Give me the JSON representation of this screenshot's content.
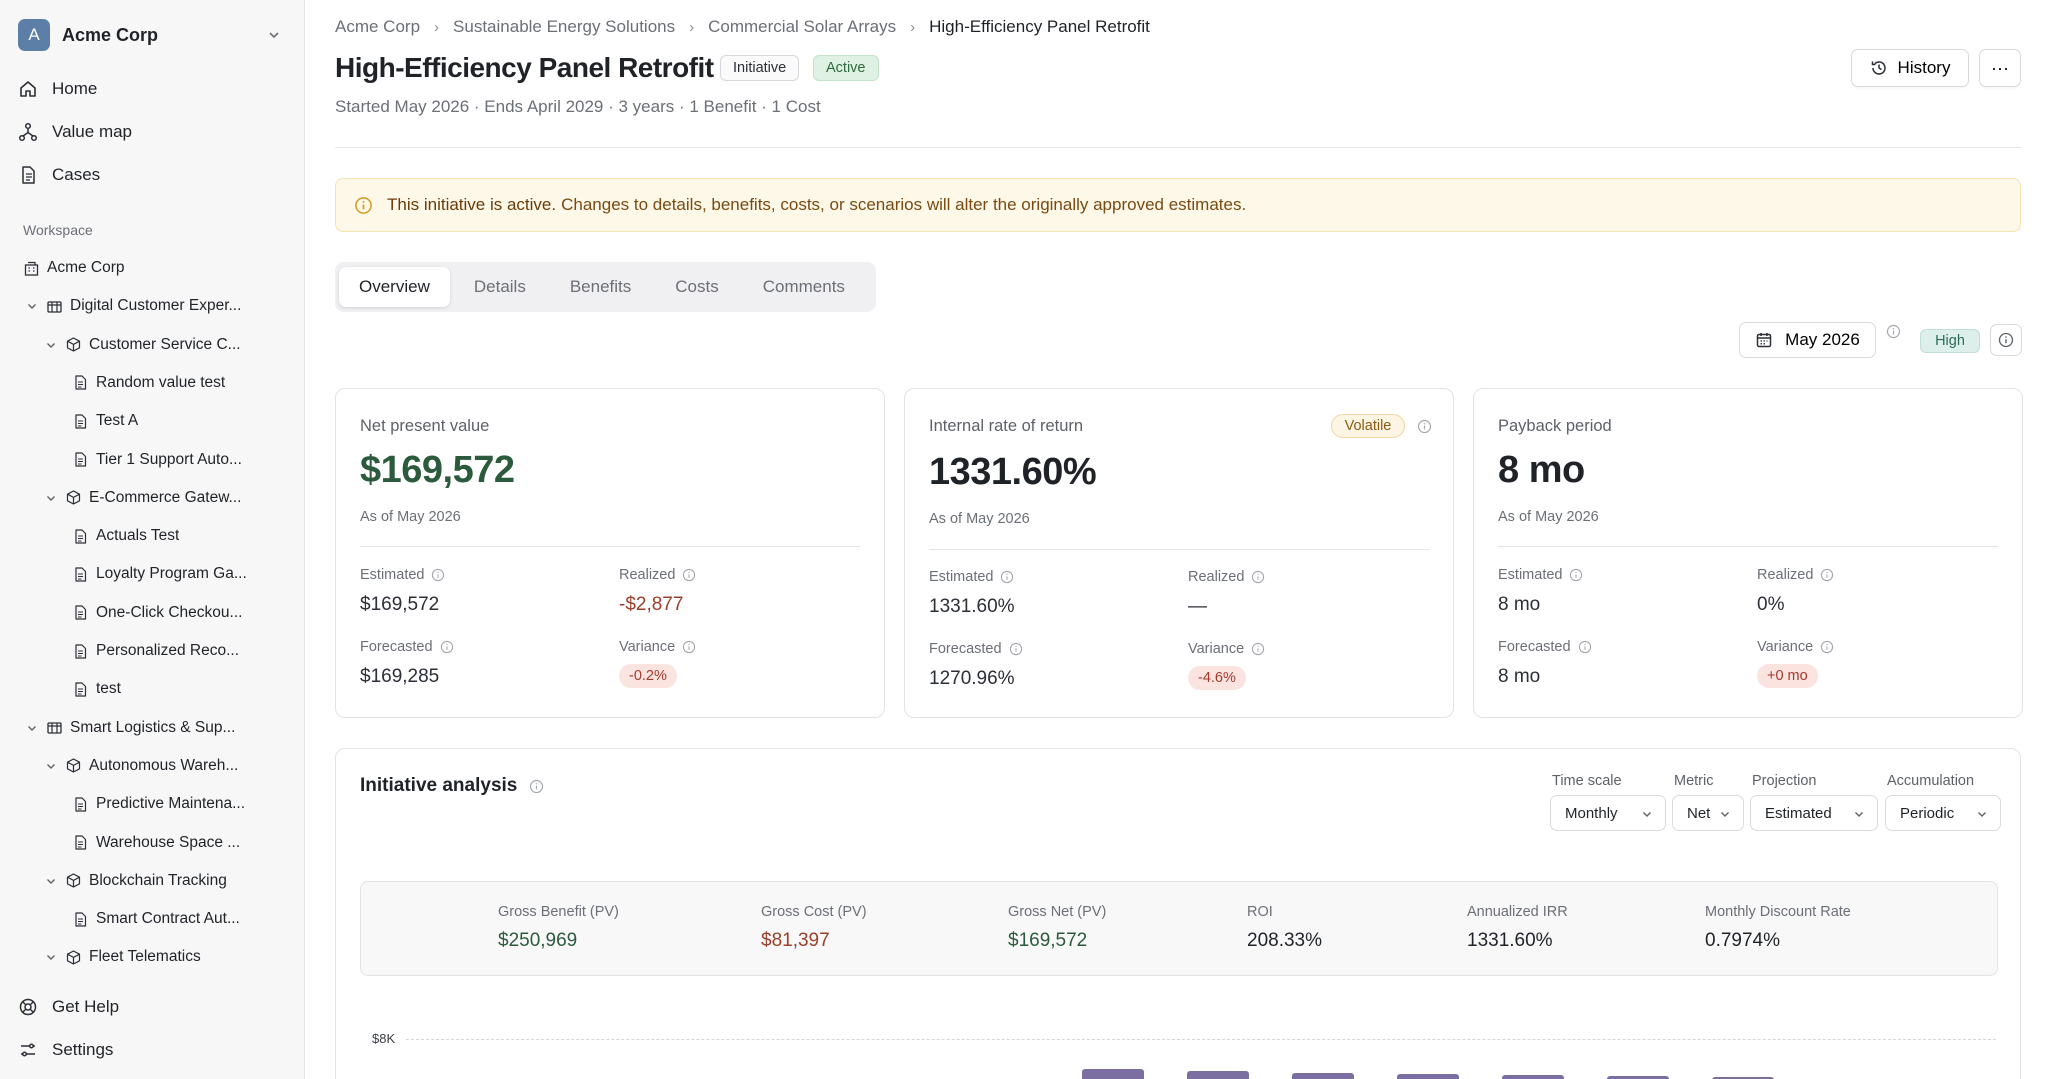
{
  "sidebar": {
    "org": {
      "initial": "A",
      "name": "Acme Corp"
    },
    "nav": [
      {
        "label": "Home",
        "icon": "home-icon"
      },
      {
        "label": "Value map",
        "icon": "value-map-icon"
      },
      {
        "label": "Cases",
        "icon": "document-icon"
      }
    ],
    "workspace_label": "Workspace",
    "tree": [
      {
        "label": "Acme Corp",
        "type": "org",
        "level": 0
      },
      {
        "label": "Digital Customer Exper...",
        "type": "portfolio",
        "level": 1
      },
      {
        "label": "Customer Service C...",
        "type": "program",
        "level": 2
      },
      {
        "label": "Random value test",
        "type": "case",
        "level": 3
      },
      {
        "label": "Test A",
        "type": "case",
        "level": 3
      },
      {
        "label": "Tier 1 Support Auto...",
        "type": "case",
        "level": 3
      },
      {
        "label": "E-Commerce Gatew...",
        "type": "program",
        "level": 2
      },
      {
        "label": "Actuals Test",
        "type": "case",
        "level": 3
      },
      {
        "label": "Loyalty Program Ga...",
        "type": "case",
        "level": 3
      },
      {
        "label": "One-Click Checkou...",
        "type": "case",
        "level": 3
      },
      {
        "label": "Personalized Reco...",
        "type": "case",
        "level": 3
      },
      {
        "label": "test",
        "type": "case",
        "level": 3
      },
      {
        "label": "Smart Logistics & Sup...",
        "type": "portfolio",
        "level": 1
      },
      {
        "label": "Autonomous Wareh...",
        "type": "program",
        "level": 2
      },
      {
        "label": "Predictive Maintena...",
        "type": "case",
        "level": 3
      },
      {
        "label": "Warehouse Space ...",
        "type": "case",
        "level": 3
      },
      {
        "label": "Blockchain Tracking",
        "type": "program",
        "level": 2
      },
      {
        "label": "Smart Contract Aut...",
        "type": "case",
        "level": 3
      },
      {
        "label": "Fleet Telematics",
        "type": "program",
        "level": 2
      }
    ],
    "footer": [
      {
        "label": "Get Help",
        "icon": "help-icon"
      },
      {
        "label": "Settings",
        "icon": "settings-icon"
      }
    ]
  },
  "breadcrumb": [
    "Acme Corp",
    "Sustainable Energy Solutions",
    "Commercial Solar Arrays",
    "High-Efficiency Panel Retrofit"
  ],
  "header": {
    "title": "High-Efficiency Panel Retrofit",
    "tag_type": "Initiative",
    "tag_status": "Active",
    "subtitle": "Started May 2026 · Ends April 2029 · 3 years · 1 Benefit · 1 Cost",
    "history_label": "History",
    "more_label": "···"
  },
  "alert": {
    "strong": "This initiative is active.",
    "text": "Changes to details, benefits, costs, or scenarios will alter the originally approved estimates."
  },
  "tabs": [
    "Overview",
    "Details",
    "Benefits",
    "Costs",
    "Comments"
  ],
  "active_tab": "Overview",
  "date_selector": "May 2026",
  "confidence": "High",
  "cards": {
    "npv": {
      "label": "Net present value",
      "value": "$169,572",
      "as_of": "As of May 2026",
      "estimated_label": "Estimated",
      "estimated": "$169,572",
      "realized_label": "Realized",
      "realized": "-$2,877",
      "forecasted_label": "Forecasted",
      "forecasted": "$169,285",
      "variance_label": "Variance",
      "variance": "-0.2%"
    },
    "irr": {
      "label": "Internal rate of return",
      "badge": "Volatile",
      "value": "1331.60%",
      "as_of": "As of May 2026",
      "estimated_label": "Estimated",
      "estimated": "1331.60%",
      "realized_label": "Realized",
      "realized": "—",
      "forecasted_label": "Forecasted",
      "forecasted": "1270.96%",
      "variance_label": "Variance",
      "variance": "-4.6%"
    },
    "payback": {
      "label": "Payback period",
      "value": "8 mo",
      "as_of": "As of May 2026",
      "estimated_label": "Estimated",
      "estimated": "8 mo",
      "realized_label": "Realized",
      "realized": "0%",
      "forecasted_label": "Forecasted",
      "forecasted": "8 mo",
      "variance_label": "Variance",
      "variance": "+0 mo"
    }
  },
  "analysis": {
    "title": "Initiative analysis",
    "controls": {
      "time_scale": {
        "label": "Time scale",
        "value": "Monthly"
      },
      "metric": {
        "label": "Metric",
        "value": "Net"
      },
      "projection": {
        "label": "Projection",
        "value": "Estimated"
      },
      "accumulation": {
        "label": "Accumulation",
        "value": "Periodic"
      }
    },
    "summary": [
      {
        "label": "Gross Benefit (PV)",
        "value": "$250,969",
        "tone": "green"
      },
      {
        "label": "Gross Cost (PV)",
        "value": "$81,397",
        "tone": "red"
      },
      {
        "label": "Gross Net (PV)",
        "value": "$169,572",
        "tone": "green"
      },
      {
        "label": "ROI",
        "value": "208.33%",
        "tone": ""
      },
      {
        "label": "Annualized IRR",
        "value": "1331.60%",
        "tone": ""
      },
      {
        "label": "Monthly Discount Rate",
        "value": "0.7974%",
        "tone": ""
      }
    ],
    "chart_top_tick": "$8K"
  },
  "colors": {
    "accent_green": "#2c5a3c",
    "cost_red": "#9a3f2a",
    "bar": "#7a6fa0",
    "alert_bg": "#fdf8e8"
  }
}
